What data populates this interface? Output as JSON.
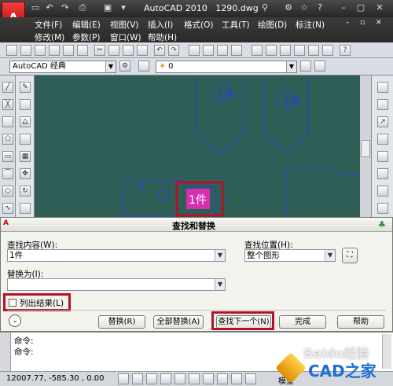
{
  "app": {
    "title": "AutoCAD 2010",
    "file": "1290.dwg"
  },
  "menu_row1": [
    "文件(F)",
    "编辑(E)",
    "视图(V)",
    "插入(I)",
    "格式(O)",
    "工具(T)",
    "绘图(D)",
    "标注(N)"
  ],
  "menu_row2": [
    "修改(M)",
    "参数(P)",
    "窗口(W)",
    "帮助(H)"
  ],
  "workspace": {
    "value": "AutoCAD 经典"
  },
  "layer": {
    "value": "0"
  },
  "drawing_texts": [
    "1件",
    "1件",
    "1件"
  ],
  "dialog": {
    "title": "查找和替换",
    "find_label": "查找内容(W):",
    "find_value": "1件",
    "where_label": "查找位置(H):",
    "where_value": "整个图形",
    "replace_label": "替换为(I):",
    "replace_value": "",
    "list_results_label": "列出结果(L)",
    "list_results_checked": false,
    "buttons": {
      "replace": "替换(R)",
      "replace_all": "全部替换(A)",
      "find_next": "查找下一个(N)",
      "done": "完成",
      "help": "帮助"
    }
  },
  "command": {
    "line1": "命令:",
    "line2": "命令:"
  },
  "status": {
    "coords": "12007.77, -585.30 , 0.00",
    "model_tab": "模型"
  },
  "watermark": {
    "brand": "Baidu经验",
    "site": "CAD之家"
  },
  "colors": {
    "canvas": "#2f5e57",
    "drawing": "#2a3fd0",
    "highlight": "#d62fb0",
    "callout": "#b3122b"
  }
}
